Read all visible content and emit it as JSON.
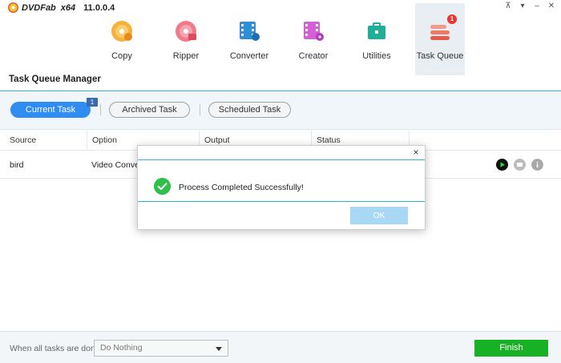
{
  "app": {
    "brand": "DVDFab",
    "arch": "x64",
    "version": "11.0.0.4"
  },
  "window_controls": [
    "pin-icon",
    "dropdown-icon",
    "minimize-icon",
    "close-icon"
  ],
  "toolbar": {
    "items": [
      {
        "label": "Copy",
        "icon": "copy-disc-icon"
      },
      {
        "label": "Ripper",
        "icon": "ripper-disc-icon"
      },
      {
        "label": "Converter",
        "icon": "converter-film-icon"
      },
      {
        "label": "Creator",
        "icon": "creator-film-icon"
      },
      {
        "label": "Utilities",
        "icon": "utilities-toolbox-icon"
      },
      {
        "label": "Task Queue",
        "icon": "task-queue-icon",
        "badge": "1",
        "active": true
      }
    ]
  },
  "page": {
    "title": "Task Queue Manager"
  },
  "tabs": {
    "current": "Current Task",
    "current_badge": "1",
    "archived": "Archived Task",
    "scheduled": "Scheduled Task"
  },
  "table": {
    "columns": [
      "Source",
      "Option",
      "Output",
      "Status"
    ],
    "rows": [
      {
        "source": "bird",
        "option": "Video Converter",
        "output": "",
        "status": ""
      }
    ]
  },
  "dialog": {
    "message": "Process Completed Successfully!",
    "ok_label": "OK",
    "close_label": "×"
  },
  "bottom": {
    "when_label": "When all tasks are done:",
    "select_value": "Do Nothing",
    "finish_label": "Finish"
  },
  "colors": {
    "accent_blue": "#2f8cf0",
    "cyan_line": "#38b5d4",
    "finish_green": "#18b024",
    "success_green": "#2fbf4a",
    "badge_red": "#e33333"
  }
}
